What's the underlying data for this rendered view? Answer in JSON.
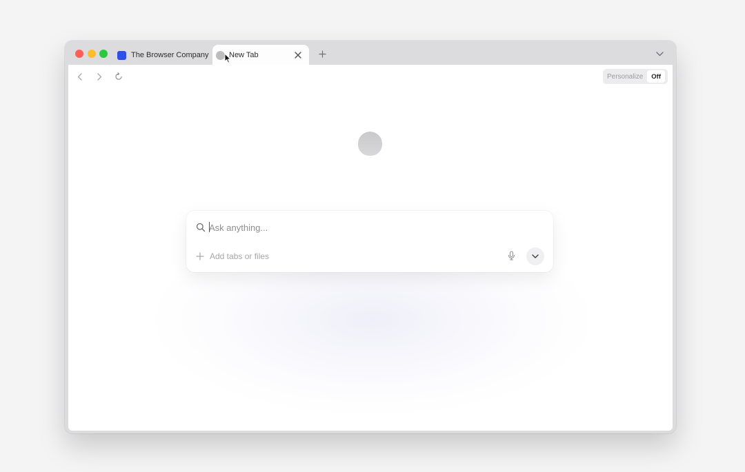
{
  "tabs": [
    {
      "label": "The Browser Company",
      "favicon": "browser-company-icon",
      "active": false
    },
    {
      "label": "New Tab",
      "favicon": "new-tab-icon",
      "active": true
    }
  ],
  "toolbar": {
    "personalize_label": "Personalize",
    "personalize_state": "Off"
  },
  "ask": {
    "placeholder": "Ask anything...",
    "add_label": "Add tabs or files"
  },
  "colors": {
    "close": "#ff5f57",
    "minimize": "#febc2e",
    "maximize": "#28c840",
    "favicon_blue": "#2f4fe8"
  },
  "icons": {
    "close_tab": "close-icon",
    "new_tab": "plus-icon",
    "tab_menu": "chevron-down-icon",
    "back": "chevron-left-icon",
    "forward": "chevron-right-icon",
    "reload": "reload-icon",
    "search": "search-icon",
    "add": "plus-icon",
    "mic": "microphone-icon",
    "model": "chevron-down-icon"
  }
}
